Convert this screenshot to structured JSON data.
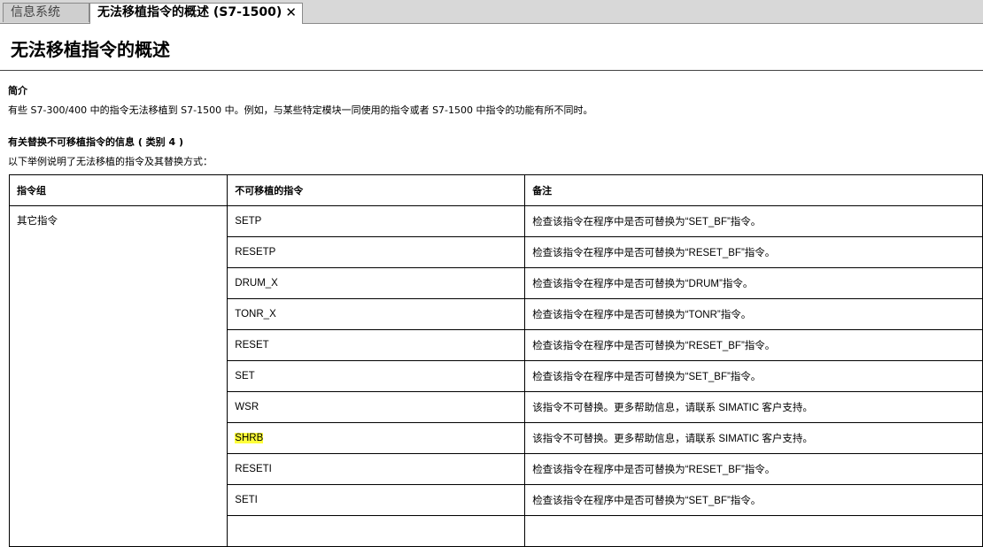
{
  "tabs": [
    {
      "label": "信息系统"
    },
    {
      "label": "无法移植指令的概述 (S7-1500)"
    }
  ],
  "close_glyph": "✕",
  "page_title": "无法移植指令的概述",
  "section1": {
    "heading": "简介",
    "text": "有些 S7-300/400 中的指令无法移植到 S7-1500 中。例如，与某些特定模块一同使用的指令或者 S7-1500 中指令的功能有所不同时。"
  },
  "section2": {
    "heading": "有关替换不可移植指令的信息 ( 类别 4 )",
    "text": "以下举例说明了无法移植的指令及其替换方式："
  },
  "table": {
    "headers": [
      "指令组",
      "不可移植的指令",
      "备注"
    ],
    "group": "其它指令",
    "rows": [
      {
        "instr": "SETP",
        "note": "检查该指令在程序中是否可替换为“SET_BF”指令。"
      },
      {
        "instr": "RESETP",
        "note": "检查该指令在程序中是否可替换为“RESET_BF”指令。"
      },
      {
        "instr": "DRUM_X",
        "note": "检查该指令在程序中是否可替换为“DRUM”指令。"
      },
      {
        "instr": "TONR_X",
        "note": "检查该指令在程序中是否可替换为“TONR”指令。"
      },
      {
        "instr": "RESET",
        "note": "检查该指令在程序中是否可替换为“RESET_BF”指令。"
      },
      {
        "instr": "SET",
        "note": "检查该指令在程序中是否可替换为“SET_BF”指令。"
      },
      {
        "instr": "WSR",
        "note": "该指令不可替换。更多帮助信息，请联系 SIMATIC 客户支持。"
      },
      {
        "instr": "SHRB",
        "note": "该指令不可替换。更多帮助信息，请联系 SIMATIC 客户支持。"
      },
      {
        "instr": "RESETI",
        "note": "检查该指令在程序中是否可替换为“RESET_BF”指令。"
      },
      {
        "instr": "SETI",
        "note": "检查该指令在程序中是否可替换为“SET_BF”指令。"
      }
    ]
  },
  "highlight_color": "#ffff3a"
}
